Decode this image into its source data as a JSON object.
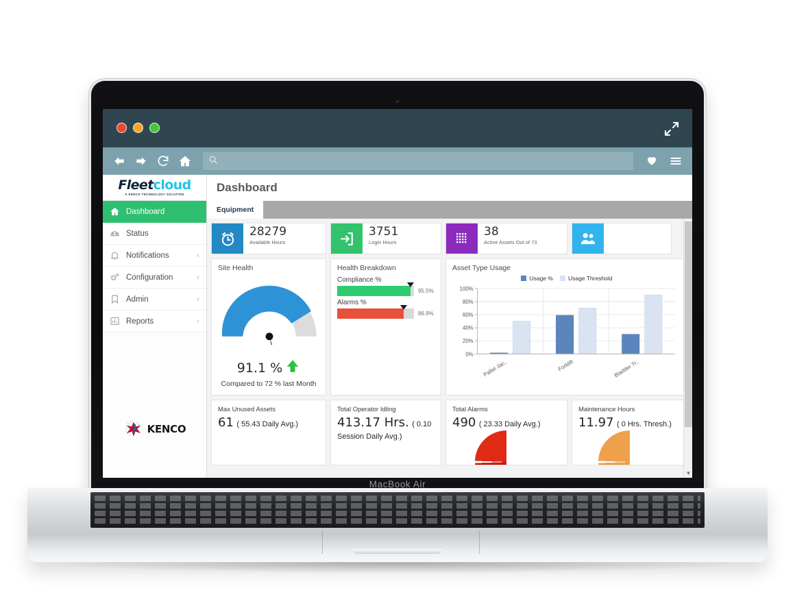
{
  "device": {
    "label": "MacBook Air"
  },
  "browser": {
    "window_controls": [
      "close",
      "minimize",
      "maximize"
    ],
    "expand_icon": "expand-arrows-icon",
    "nav": {
      "back": "back-arrow-icon",
      "forward": "forward-arrow-icon",
      "reload": "reload-icon",
      "home": "home-icon",
      "search_icon": "search-icon",
      "url_value": "",
      "url_placeholder": "",
      "favorite": "heart-icon",
      "menu": "hamburger-menu-icon"
    }
  },
  "brand": {
    "name_part1": "Fleet",
    "name_part2": "cloud",
    "tagline": "A KENCO TECHNOLOGY SOLUTION",
    "footer_logo": "KENCO",
    "colors": {
      "fleet": "#10243a",
      "cloud": "#22c4e6",
      "accent_green": "#2fbf71"
    }
  },
  "sidebar": {
    "items": [
      {
        "label": "Dashboard",
        "icon": "home-icon",
        "active": true,
        "chevron": ""
      },
      {
        "label": "Status",
        "icon": "gauge-icon",
        "active": false,
        "chevron": ""
      },
      {
        "label": "Notifications",
        "icon": "bell-icon",
        "active": false,
        "chevron": "‹"
      },
      {
        "label": "Configuration",
        "icon": "gears-icon",
        "active": false,
        "chevron": "‹"
      },
      {
        "label": "Admin",
        "icon": "bookmark-icon",
        "active": false,
        "chevron": "‹"
      },
      {
        "label": "Reports",
        "icon": "bar-chart-icon",
        "active": false,
        "chevron": "‹"
      }
    ]
  },
  "header": {
    "title": "Dashboard"
  },
  "tabs": [
    {
      "label": "Equipment",
      "active": true
    }
  ],
  "kpis": [
    {
      "value": "28279",
      "label": "Available Hours",
      "icon": "alarm-clock-icon",
      "color": "#2388c4"
    },
    {
      "value": "3751",
      "label": "Login Hours",
      "icon": "login-arrow-icon",
      "color": "#32c36c"
    },
    {
      "value": "38",
      "label": "Active Assets Out of 73",
      "icon": "grid-icon",
      "color": "#8a2bbd"
    },
    {
      "value": "",
      "label": "",
      "icon": "users-icon",
      "color": "#31b3ee"
    }
  ],
  "site_health": {
    "title": "Site Health",
    "value": "91.1 %",
    "trend": "up-arrow-icon",
    "comparison": "Compared to 72 % last Month",
    "gauge_percent": 91.1,
    "arc_color": "#2e93d6",
    "track_color": "#dcdcdc"
  },
  "health_breakdown": {
    "title": "Health Breakdown",
    "bars": [
      {
        "label": "Compliance %",
        "value": "95.5%",
        "percent": 95.5,
        "color": "#2ecc71"
      },
      {
        "label": "Alarms %",
        "value": "86.9%",
        "percent": 86.9,
        "color": "#e8503a"
      }
    ]
  },
  "chart_data": {
    "type": "bar",
    "title": "Asset Type Usage",
    "categories": [
      "Pallet Jac..",
      "Forklift",
      "Bladder Tr.."
    ],
    "series": [
      {
        "name": "Usage %",
        "values": [
          1,
          59,
          30
        ],
        "color": "#5b86bd"
      },
      {
        "name": "Usage Threshold",
        "values": [
          50,
          70,
          90
        ],
        "color": "#d9e3f2"
      }
    ],
    "ylabel": "",
    "xlabel": "",
    "ylim": [
      0,
      100
    ],
    "yticks": [
      "0%",
      "20%",
      "40%",
      "60%",
      "80%",
      "100%"
    ],
    "grid": true,
    "legend_position": "top"
  },
  "stats": [
    {
      "title": "Max Unused Assets",
      "big": "61",
      "small": "( 55.43 Daily Avg.)",
      "chart": "none"
    },
    {
      "title": "Total Operator Idling",
      "big": "413.17 Hrs.",
      "small": "( 0.10 Session Daily Avg.)",
      "chart": "none"
    },
    {
      "title": "Total Alarms",
      "big": "490",
      "small": "( 23.33 Daily Avg.)",
      "chart": "donut-red"
    },
    {
      "title": "Maintenance Hours",
      "big": "11.97",
      "small": "( 0 Hrs. Thresh.)",
      "chart": "donut-orange"
    }
  ],
  "scrollbar": {
    "down_arrow": "▼"
  }
}
